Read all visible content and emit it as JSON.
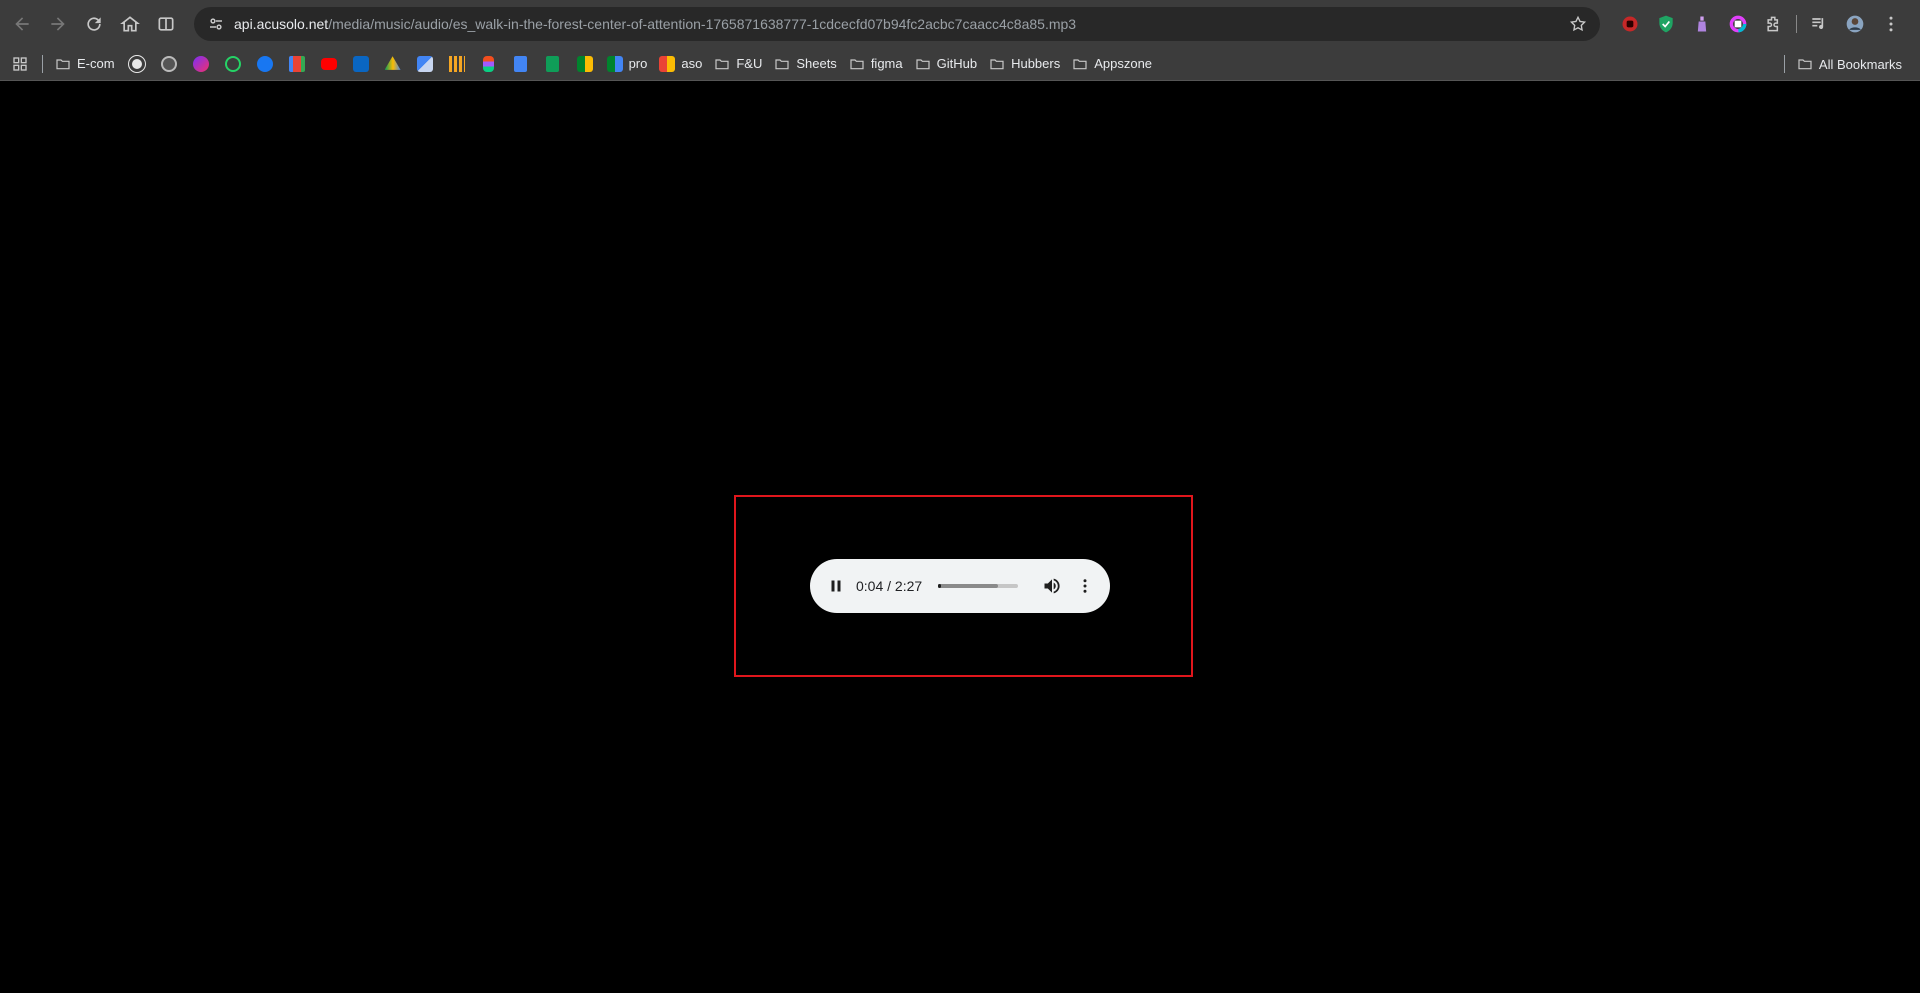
{
  "browser": {
    "url_host": "api.acusolo.net",
    "url_path": "/media/music/audio/es_walk-in-the-forest-center-of-attention-1765871638777-1cdcecfd07b94fc2acbc7caacc4c8a85.mp3"
  },
  "bookmarks": {
    "items": [
      {
        "label": "E-com"
      },
      {
        "label": "pro"
      },
      {
        "label": "aso"
      },
      {
        "label": "F&U"
      },
      {
        "label": "Sheets"
      },
      {
        "label": "figma"
      },
      {
        "label": "GitHub"
      },
      {
        "label": "Hubbers"
      },
      {
        "label": "Appszone"
      }
    ],
    "all_label": "All Bookmarks"
  },
  "player": {
    "time": "0:04 / 2:27",
    "progress_fraction": 0.03,
    "buffered_fraction": 0.75
  },
  "colors": {
    "highlight": "#e0161c",
    "player_bg": "#f1f3f4",
    "toolbar_bg": "#3c3c3c",
    "page_bg": "#000000"
  }
}
